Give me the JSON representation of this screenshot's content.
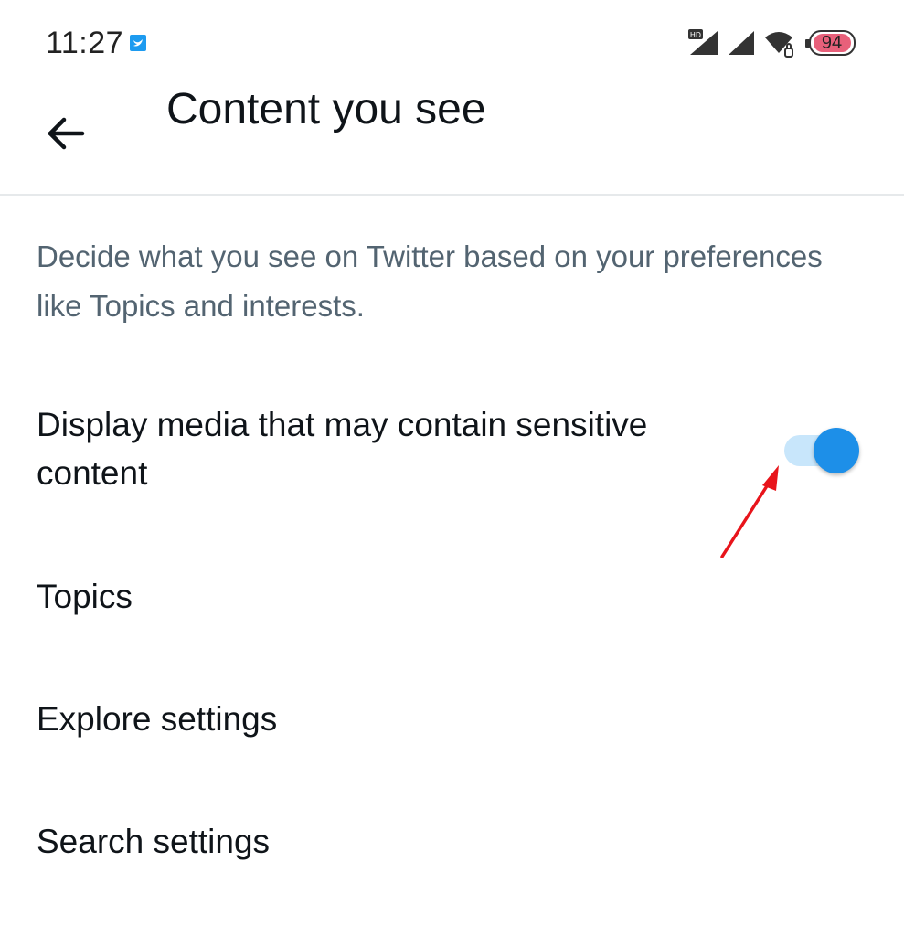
{
  "status_bar": {
    "time": "11:27",
    "battery_level": "94",
    "icons": [
      "twitter-notification-icon",
      "hd-signal-icon",
      "signal-icon",
      "wifi-icon",
      "battery-icon"
    ]
  },
  "header": {
    "title": "Content you see",
    "back_icon": "arrow-left-icon"
  },
  "description": "Decide what you see on Twitter based on your preferences like Topics and interests.",
  "settings": {
    "sensitive_media": {
      "label": "Display media that may contain sensitive content",
      "enabled": true
    },
    "topics": {
      "label": "Topics"
    },
    "explore": {
      "label": "Explore settings"
    },
    "search": {
      "label": "Search settings"
    }
  },
  "colors": {
    "accent": "#1d8fe8",
    "toggle_track": "#c8e6fb",
    "description_text": "#536471",
    "annotation": "#e8141b"
  }
}
